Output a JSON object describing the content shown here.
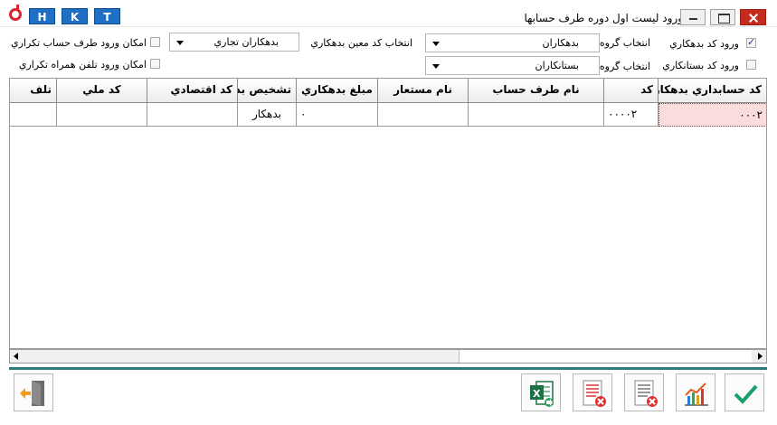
{
  "titlebar": {
    "title": "ورود ليست اول دوره طرف حسابها",
    "hk_buttons": [
      "H",
      "K",
      "T"
    ]
  },
  "filters": {
    "debtor_code": {
      "label": "ورود کد بدهکاري",
      "checked": true
    },
    "creditor_code": {
      "label": "ورود کد بستانکاري",
      "checked": false
    },
    "group_label_1": "انتخاب گروه",
    "group_label_2": "انتخاب گروه",
    "group_1_value": "بدهکاران",
    "group_2_value": "بستانکاران",
    "detail_label": "انتخاب کد معين بدهکاري",
    "detail_value": "بدهکاران تجاري",
    "allow_duplicate": {
      "label": "امکان ورود طرف حساب تکراري",
      "checked": false
    },
    "allow_mobile": {
      "label": "امکان ورود تلفن همراه تکراري",
      "checked": false
    }
  },
  "grid": {
    "columns": [
      "کد حسابداري بدهکار",
      "کد",
      "نام طرف حساب",
      "نام مستعار",
      "مبلغ بدهکاري",
      "تشخيص بد",
      "کد اقتصادي",
      "کد ملي",
      "تلف"
    ],
    "row": [
      "۰۰۰۲",
      "۰۰۰۰۲",
      "",
      "",
      "۰",
      "بدهکار",
      "",
      "",
      ""
    ]
  },
  "toolbar": {
    "icons": [
      "confirm-check-icon",
      "chart-icon",
      "delete-row-icon",
      "delete-all-icon",
      "excel-import-icon",
      "exit-icon"
    ]
  },
  "colors": {
    "accent": "#1f6fc5",
    "close": "#c42b1c",
    "separator": "#2e7d7d",
    "selected_cell": "#fbdcdc",
    "confirm": "#1aa06b"
  }
}
